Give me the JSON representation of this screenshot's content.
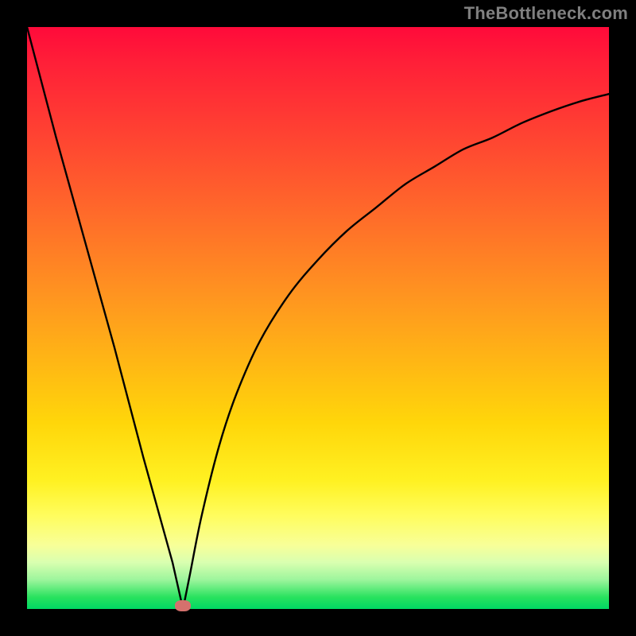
{
  "attribution": "TheBottleneck.com",
  "colors": {
    "page_bg": "#000000",
    "attribution_text": "#808080",
    "curve_stroke": "#000000",
    "marker_fill": "#d4716d",
    "gradient_stops": [
      "#ff0a3a",
      "#ff4132",
      "#ff9420",
      "#ffd60a",
      "#fff122",
      "#f8ff98",
      "#28e25e",
      "#00d864"
    ]
  },
  "chart_data": {
    "type": "line",
    "title": "",
    "xlabel": "",
    "ylabel": "",
    "xlim": [
      0,
      100
    ],
    "ylim": [
      0,
      100
    ],
    "grid": false,
    "legend_position": "none",
    "description": "V-shaped bottleneck curve: steep linear descent from top-left to a minimum near x≈27, then an asymptotic rise toward the right. Background is a vertical red→green gradient.",
    "series": [
      {
        "name": "left-arm",
        "x": [
          0,
          5,
          10,
          15,
          20,
          25,
          26.8
        ],
        "y": [
          100,
          81,
          63,
          45,
          26,
          8,
          0
        ]
      },
      {
        "name": "right-arm",
        "x": [
          26.8,
          28,
          30,
          33,
          36,
          40,
          45,
          50,
          55,
          60,
          65,
          70,
          75,
          80,
          85,
          90,
          95,
          100
        ],
        "y": [
          0,
          6,
          16,
          28,
          37,
          46,
          54,
          60,
          65,
          69,
          73,
          76,
          79,
          81,
          83.5,
          85.5,
          87.2,
          88.5
        ]
      }
    ],
    "minimum_point": {
      "x": 26.8,
      "y": 0
    },
    "marker": {
      "x": 26.8,
      "y": 0.5,
      "color": "#d4716d"
    }
  }
}
